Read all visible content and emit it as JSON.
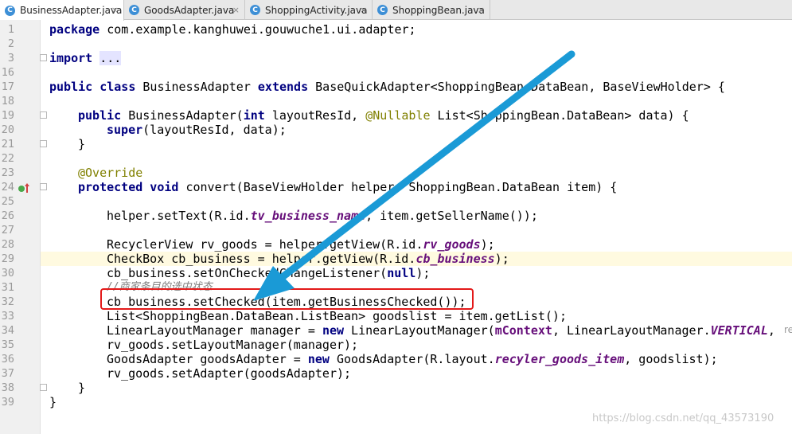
{
  "tabs": [
    {
      "label": "BusinessAdapter.java",
      "icon": "java-class-icon",
      "active": true
    },
    {
      "label": "GoodsAdapter.java",
      "icon": "java-class-icon",
      "active": false
    },
    {
      "label": "ShoppingActivity.java",
      "icon": "java-class-icon",
      "active": false
    },
    {
      "label": "ShoppingBean.java",
      "icon": "java-class-icon",
      "active": false
    }
  ],
  "close_glyph": "×",
  "class_icon_letter": "C",
  "line_numbers": [
    "1",
    "2",
    "3",
    "16",
    "17",
    "18",
    "19",
    "20",
    "21",
    "22",
    "23",
    "24",
    "25",
    "26",
    "27",
    "28",
    "29",
    "30",
    "31",
    "32",
    "33",
    "34",
    "35",
    "36",
    "37",
    "38",
    "39"
  ],
  "code": {
    "l1_kw": "package",
    "l1_rest": " com.example.kanghuwei.gouwuche1.ui.adapter;",
    "l3_kw": "import",
    "l3_fold": "...",
    "l16_kw1": "public class",
    "l16_a": " BusinessAdapter ",
    "l16_kw2": "extends",
    "l16_b": " BaseQuickAdapter<ShoppingBean.DataBean, BaseViewHolder> {",
    "l18_kw1": "public",
    "l18_a": " BusinessAdapter(",
    "l18_kw2": "int",
    "l18_b": " layoutResId, ",
    "l18_ann": "@Nullable",
    "l18_c": " List<ShoppingBean.DataBean> data) {",
    "l19_kw": "super",
    "l19_a": "(layoutResId, data);",
    "l20": "}",
    "l22_ann": "@Override",
    "l23_kw": "protected void",
    "l23_a": " convert(BaseViewHolder helper, ShoppingBean.DataBean item) {",
    "l25_a": "helper.setText(R.id.",
    "l25_f": "tv_business_name",
    "l25_b": ", item.getSellerName());",
    "l27_a": "RecyclerView rv_goods = helper.getView(R.id.",
    "l27_f": "rv_goods",
    "l27_b": ");",
    "l28_a": "CheckBox cb_business = helper.getView(R.id.",
    "l28_f": "cb_business",
    "l28_b": ");",
    "l29_a": "cb_business.setOnCheckedChangeListener(",
    "l29_kw": "null",
    "l29_b": ");",
    "l30_cmt": "//商家条目的选中状态",
    "l31": "cb_business.setChecked(item.getBusinessChecked());",
    "l32": "List<ShoppingBean.DataBean.ListBean> goodslist = item.getList();",
    "l33_a": "LinearLayoutManager manager = ",
    "l33_kw": "new",
    "l33_b": " LinearLayoutManager(",
    "l33_f1": "mContext",
    "l33_c": ", LinearLayoutManager.",
    "l33_f2": "VERTICAL",
    "l33_d": ",",
    "l34": "rv_goods.setLayoutManager(manager);",
    "l35_a": "GoodsAdapter goodsAdapter = ",
    "l35_kw": "new",
    "l35_b": " GoodsAdapter(R.layout.",
    "l35_f": "recyler_goods_item",
    "l35_c": ", goodslist);",
    "l36": "rv_goods.setAdapter(goodsAdapter);",
    "l37": "}",
    "l38": "}"
  },
  "hint_text": "re",
  "watermark": "https://blog.csdn.net/qq_43573190",
  "colors": {
    "keyword": "#000080",
    "annotation": "#808000",
    "field": "#660e7a",
    "comment": "#808080",
    "highlight_box": "#e31919",
    "arrow": "#1a9ad6",
    "current_line": "#fffae0"
  }
}
